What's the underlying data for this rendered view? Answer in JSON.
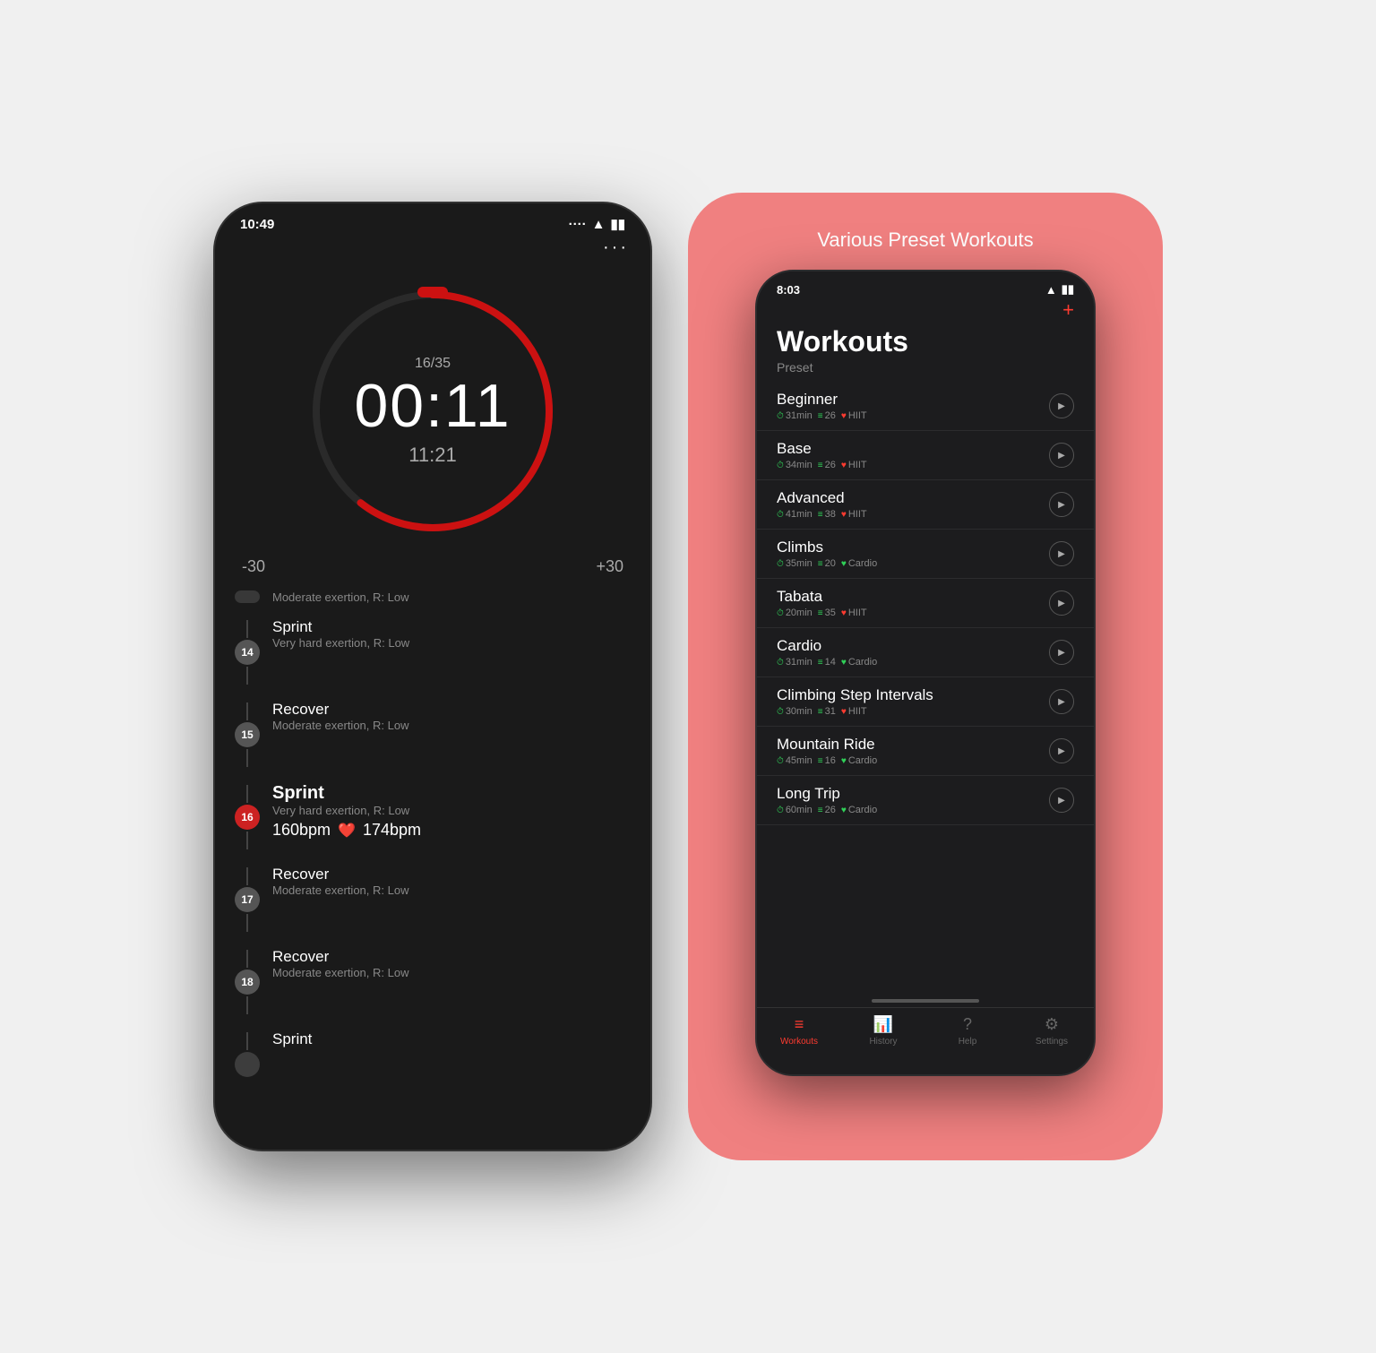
{
  "left_phone": {
    "status_bar": {
      "time": "10:49",
      "dots": "····"
    },
    "dots_menu": "···",
    "timer": {
      "lap_count": "16/35",
      "main_time": "00:11",
      "sub_time": "11:21",
      "adjust_minus": "-30",
      "adjust_plus": "+30"
    },
    "workout_steps": [
      {
        "id": "",
        "name": "Moderate exertion, R: Low",
        "desc": "",
        "active": false,
        "partial": true
      },
      {
        "id": "14",
        "name": "Sprint",
        "desc": "Very hard exertion, R: Low",
        "active": false,
        "partial": false
      },
      {
        "id": "15",
        "name": "Recover",
        "desc": "Moderate exertion, R: Low",
        "active": false,
        "partial": false
      },
      {
        "id": "16",
        "name": "Sprint",
        "desc": "Very hard exertion, R: Low",
        "active": true,
        "partial": false,
        "bpm_left": "160bpm",
        "bpm_right": "174bpm"
      },
      {
        "id": "17",
        "name": "Recover",
        "desc": "Moderate exertion, R: Low",
        "active": false,
        "partial": false
      },
      {
        "id": "18",
        "name": "Recover",
        "desc": "Moderate exertion, R: Low",
        "active": false,
        "partial": false
      },
      {
        "id": "",
        "name": "Sprint",
        "desc": "",
        "active": false,
        "partial": true
      }
    ]
  },
  "right_phone": {
    "promo_title": "Various Preset Workouts",
    "status_bar": {
      "time": "8:03"
    },
    "plus_button": "+",
    "title": "Workouts",
    "subtitle": "Preset",
    "workouts": [
      {
        "name": "Beginner",
        "time": "31min",
        "steps": "26",
        "type": "HIIT",
        "type_color": "red"
      },
      {
        "name": "Base",
        "time": "34min",
        "steps": "26",
        "type": "HIIT",
        "type_color": "red"
      },
      {
        "name": "Advanced",
        "time": "41min",
        "steps": "38",
        "type": "HIIT",
        "type_color": "red"
      },
      {
        "name": "Climbs",
        "time": "35min",
        "steps": "20",
        "type": "Cardio",
        "type_color": "green"
      },
      {
        "name": "Tabata",
        "time": "20min",
        "steps": "35",
        "type": "HIIT",
        "type_color": "red"
      },
      {
        "name": "Cardio",
        "time": "31min",
        "steps": "14",
        "type": "Cardio",
        "type_color": "green"
      },
      {
        "name": "Climbing Step Intervals",
        "time": "30min",
        "steps": "31",
        "type": "HIIT",
        "type_color": "red"
      },
      {
        "name": "Mountain Ride",
        "time": "45min",
        "steps": "16",
        "type": "Cardio",
        "type_color": "green"
      },
      {
        "name": "Long Trip",
        "time": "60min",
        "steps": "26",
        "type": "Cardio",
        "type_color": "green"
      }
    ],
    "tab_bar": [
      {
        "label": "Workouts",
        "icon": "≡",
        "active": true
      },
      {
        "label": "History",
        "icon": "📊",
        "active": false
      },
      {
        "label": "Help",
        "icon": "?",
        "active": false
      },
      {
        "label": "Settings",
        "icon": "⚙",
        "active": false
      }
    ]
  }
}
